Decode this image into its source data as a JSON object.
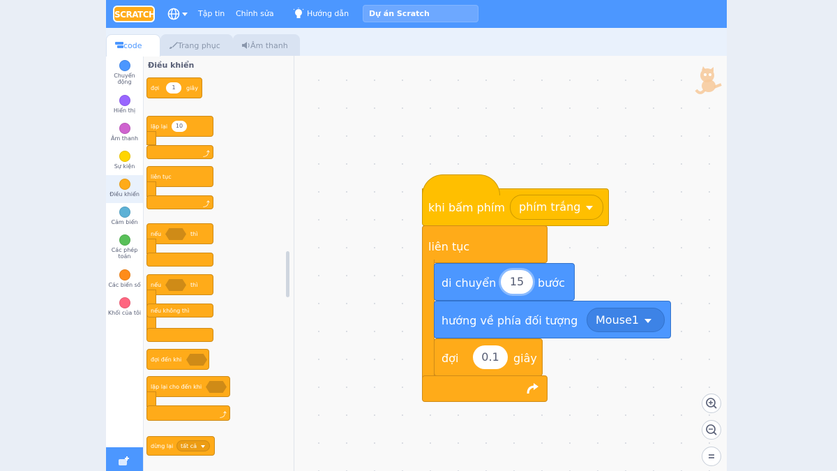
{
  "menubar": {
    "logo": "SCRATCH",
    "file": "Tập tin",
    "edit": "Chỉnh sửa",
    "tutorials": "Hướng dẫn",
    "project_title": "Dự án Scratch",
    "globe_icon": "globe-icon",
    "tutorial_icon": "lightbulb-icon"
  },
  "tabs": [
    {
      "label": "code",
      "icon": "code-icon",
      "active": true
    },
    {
      "label": "Trang phục",
      "icon": "brush-icon",
      "active": false
    },
    {
      "label": "Âm thanh",
      "icon": "speaker-icon",
      "active": false
    }
  ],
  "categories": [
    {
      "label": "Chuyển động",
      "color": "#4c97ff"
    },
    {
      "label": "Hiển thị",
      "color": "#9966ff"
    },
    {
      "label": "Âm thanh",
      "color": "#cf63cf"
    },
    {
      "label": "Sự kiện",
      "color": "#ffd500"
    },
    {
      "label": "Điều khiển",
      "color": "#ffab19",
      "selected": true
    },
    {
      "label": "Cảm biến",
      "color": "#5cb1d6"
    },
    {
      "label": "Các phép toán",
      "color": "#59c059"
    },
    {
      "label": "Các biến số",
      "color": "#ff8c1a"
    },
    {
      "label": "Khối của tôi",
      "color": "#ff6680"
    }
  ],
  "palette": {
    "title": "Điều khiển",
    "wait": "đợi",
    "wait_value": "1",
    "wait_unit": "giây",
    "repeat": "lặp lại",
    "repeat_value": "10",
    "forever": "liên tục",
    "if": "nếu",
    "then": "thì",
    "if2": "nếu",
    "then2": "thì",
    "else": "nếu không thì",
    "wait_until": "đợi đến khi",
    "repeat_until": "lặp lại cho đến khi",
    "stop": "dừng lại",
    "stop_option": "tất cả"
  },
  "script": {
    "event_label": "khi bấm phím",
    "key_option": "phím trắng",
    "forever_label": "liên tục",
    "move_label": "di chuyển",
    "move_value": "15",
    "move_unit": "bước",
    "point_label": "hướng về phía đối tượng",
    "point_option": "Mouse1",
    "wait_label": "đợi",
    "wait_value": "0.1",
    "wait_unit": "giây"
  },
  "zoom": {
    "in_icon": "zoom-in-icon",
    "out_icon": "zoom-out-icon",
    "reset_icon": "zoom-reset-icon"
  }
}
